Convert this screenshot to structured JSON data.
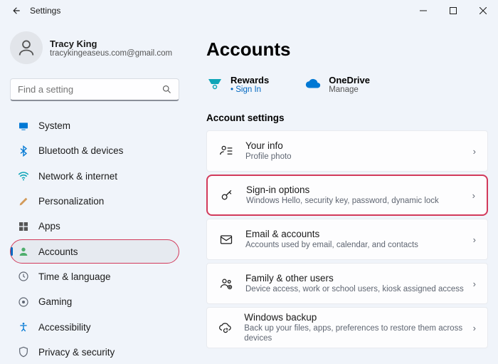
{
  "window": {
    "title": "Settings"
  },
  "user": {
    "name": "Tracy King",
    "email": "tracykingeaseus.com@gmail.com"
  },
  "search": {
    "placeholder": "Find a setting"
  },
  "nav": {
    "items": [
      {
        "label": "System"
      },
      {
        "label": "Bluetooth & devices"
      },
      {
        "label": "Network & internet"
      },
      {
        "label": "Personalization"
      },
      {
        "label": "Apps"
      },
      {
        "label": "Accounts"
      },
      {
        "label": "Time & language"
      },
      {
        "label": "Gaming"
      },
      {
        "label": "Accessibility"
      },
      {
        "label": "Privacy & security"
      }
    ]
  },
  "page": {
    "title": "Accounts",
    "top": {
      "rewards": {
        "title": "Rewards",
        "sub": "Sign In"
      },
      "onedrive": {
        "title": "OneDrive",
        "sub": "Manage"
      }
    },
    "section": "Account settings",
    "cards": [
      {
        "title": "Your info",
        "sub": "Profile photo"
      },
      {
        "title": "Sign-in options",
        "sub": "Windows Hello, security key, password, dynamic lock"
      },
      {
        "title": "Email & accounts",
        "sub": "Accounts used by email, calendar, and contacts"
      },
      {
        "title": "Family & other users",
        "sub": "Device access, work or school users, kiosk assigned access"
      },
      {
        "title": "Windows backup",
        "sub": "Back up your files, apps, preferences to restore them across devices"
      }
    ]
  }
}
